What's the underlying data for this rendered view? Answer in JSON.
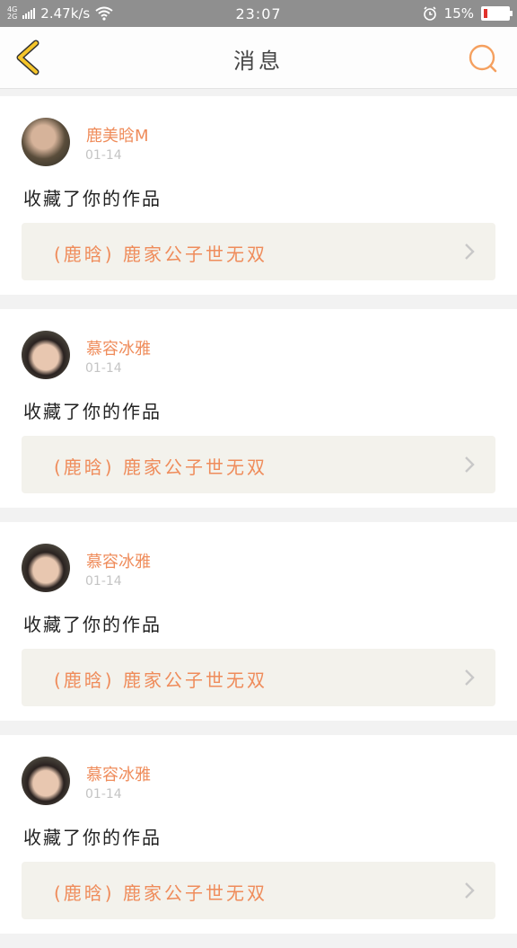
{
  "status_bar": {
    "network_top": "4G",
    "network_bottom": "2G",
    "speed": "2.47k/s",
    "time": "23:07",
    "battery": "15%",
    "battery_level": 0.15,
    "battery_color": "#e0312b"
  },
  "header": {
    "title": "消息",
    "back_icon": "chevron-left-icon",
    "search_icon": "search-icon",
    "accent": "#f5a623"
  },
  "messages": [
    {
      "username": "鹿美晗M",
      "time": "01-14",
      "action": "收藏了你的作品",
      "work": "(鹿晗) 鹿家公子世无双"
    },
    {
      "username": "慕容冰雅",
      "time": "01-14",
      "action": "收藏了你的作品",
      "work": "(鹿晗) 鹿家公子世无双"
    },
    {
      "username": "慕容冰雅",
      "time": "01-14",
      "action": "收藏了你的作品",
      "work": "(鹿晗) 鹿家公子世无双"
    },
    {
      "username": "慕容冰雅",
      "time": "01-14",
      "action": "收藏了你的作品",
      "work": "(鹿晗) 鹿家公子世无双"
    }
  ],
  "colors": {
    "name": "#ef8c5b",
    "link_bg": "#f3f2ec"
  }
}
